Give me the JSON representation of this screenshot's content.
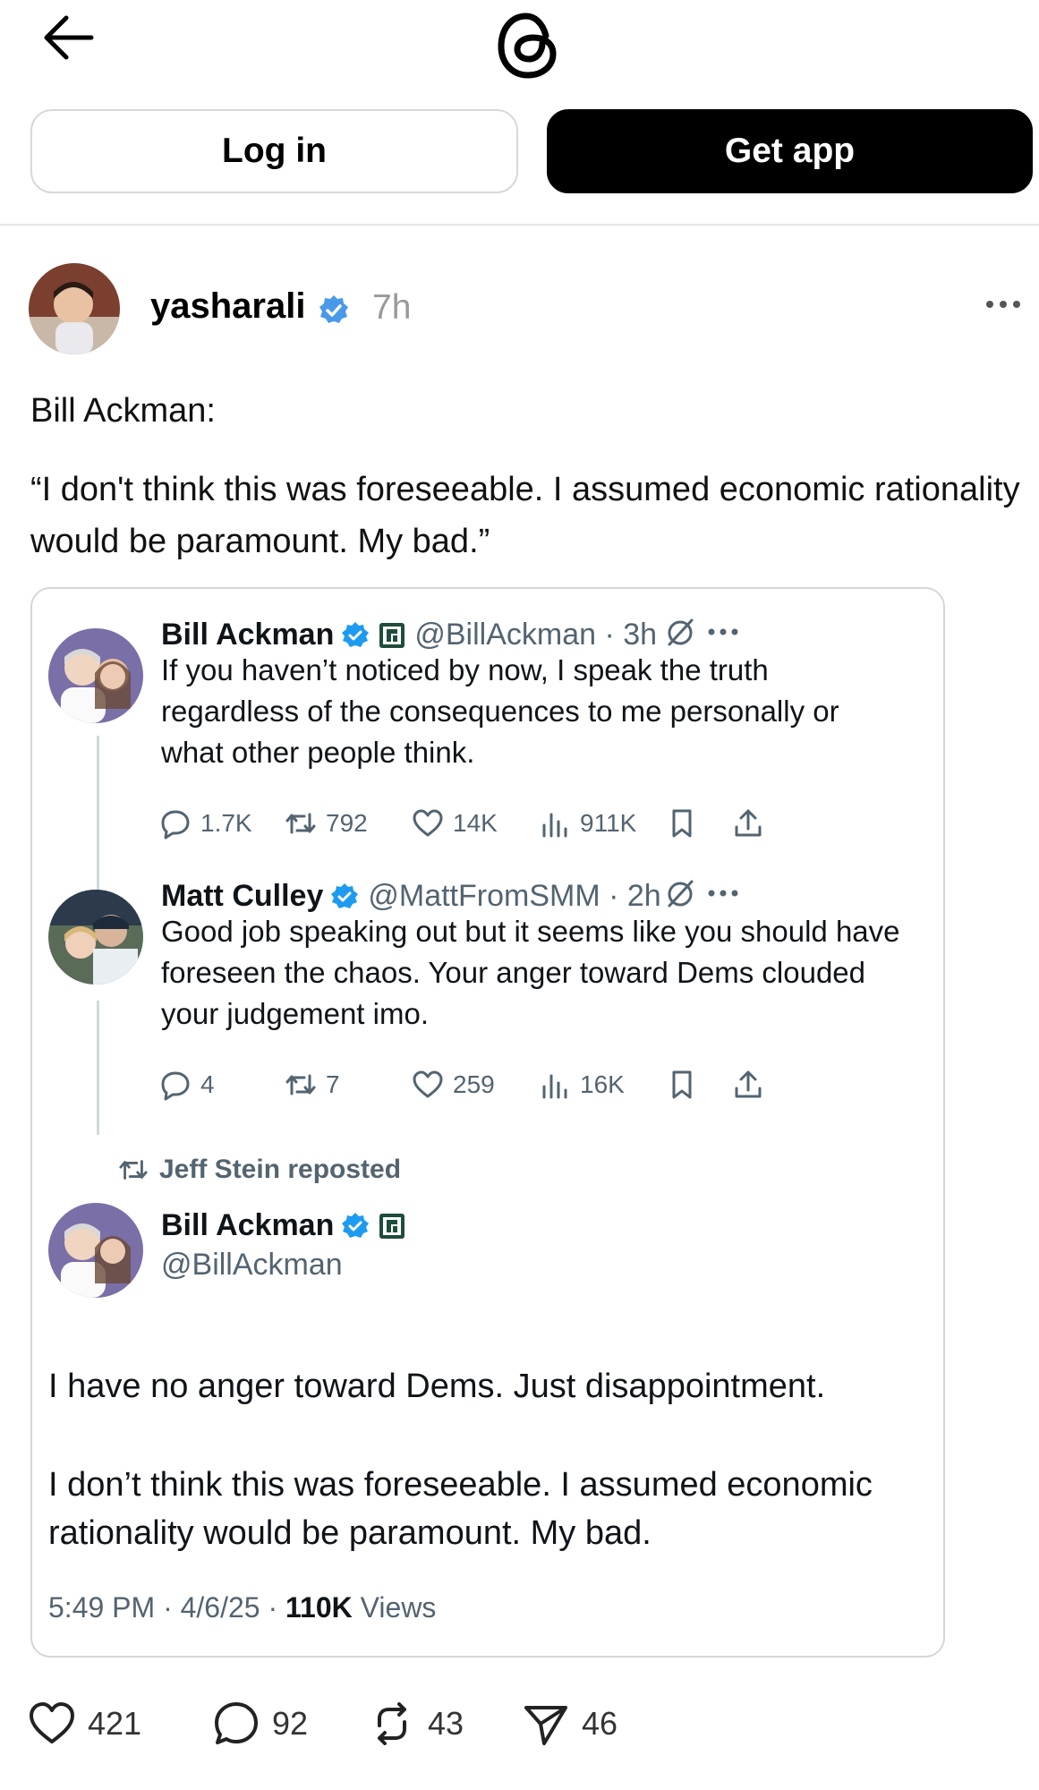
{
  "topbar": {
    "back_icon": "arrow-left-icon",
    "logo": "threads-logo"
  },
  "auth": {
    "login_label": "Log in",
    "getapp_label": "Get app"
  },
  "post": {
    "username": "yasharali",
    "time": "7h",
    "line1": "Bill Ackman:",
    "line2": "“I don't think this was foreseeable. I assumed economic rationality would be paramount. My bad.”",
    "stats": {
      "likes": "421",
      "replies": "92",
      "reposts": "43",
      "shares": "46"
    }
  },
  "quote": {
    "tweet1": {
      "name": "Bill Ackman",
      "handle": "@BillAckman · 3h",
      "text": "If you haven’t noticed by now, I speak the truth regardless of the consequences to me personally or what other people think.",
      "replies": "1.7K",
      "reposts": "792",
      "likes": "14K",
      "views": "911K"
    },
    "tweet2": {
      "name": "Matt Culley",
      "handle": "@MattFromSMM · 2h",
      "text": "Good job speaking out but it seems like you should have foreseen the chaos. Your anger toward Dems clouded your judgement imo.",
      "replies": "4",
      "reposts": "7",
      "likes": "259",
      "views": "16K"
    },
    "reposted_by": "Jeff Stein reposted",
    "tweet3": {
      "name": "Bill Ackman",
      "handle": "@BillAckman",
      "para1": "I have no anger toward Dems. Just disappointment.",
      "para2": "I don’t think this was foreseeable. I assumed economic rationality would be paramount. My bad.",
      "meta_time": "5:49 PM · 4/6/25 · ",
      "meta_views": "110K",
      "meta_views_label": " Views"
    }
  },
  "colors": {
    "verified_blue": "#4a99e9",
    "x_gray": "#536471",
    "button_black": "#000000"
  }
}
